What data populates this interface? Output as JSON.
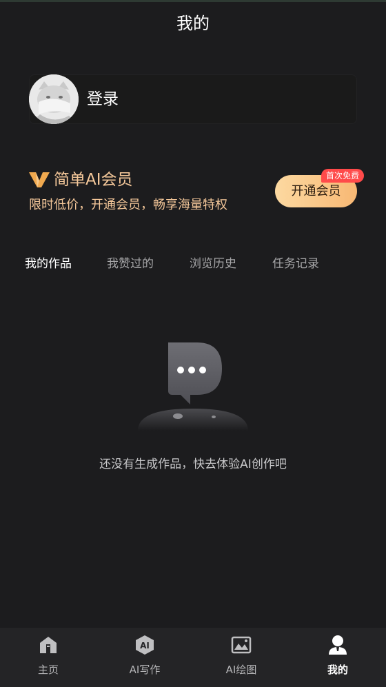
{
  "header": {
    "title": "我的"
  },
  "profile": {
    "login_label": "登录"
  },
  "vip": {
    "title": "简单AI会员",
    "subtitle": "限时低价，开通会员，畅享海量特权",
    "button_label": "开通会员",
    "badge": "首次免费",
    "accent_color": "#f5c89a",
    "badge_color": "#ff4a4a"
  },
  "tabs": [
    {
      "label": "我的作品",
      "active": true
    },
    {
      "label": "我赞过的",
      "active": false
    },
    {
      "label": "浏览历史",
      "active": false
    },
    {
      "label": "任务记录",
      "active": false
    }
  ],
  "empty_state": {
    "icon": "empty-chat-bubble-icon",
    "text": "还没有生成作品，快去体验AI创作吧"
  },
  "bottom_nav": [
    {
      "label": "主页",
      "icon": "home-icon",
      "active": false
    },
    {
      "label": "AI写作",
      "icon": "ai-writing-icon",
      "active": false
    },
    {
      "label": "AI绘图",
      "icon": "ai-drawing-icon",
      "active": false
    },
    {
      "label": "我的",
      "icon": "profile-icon",
      "active": true
    }
  ]
}
